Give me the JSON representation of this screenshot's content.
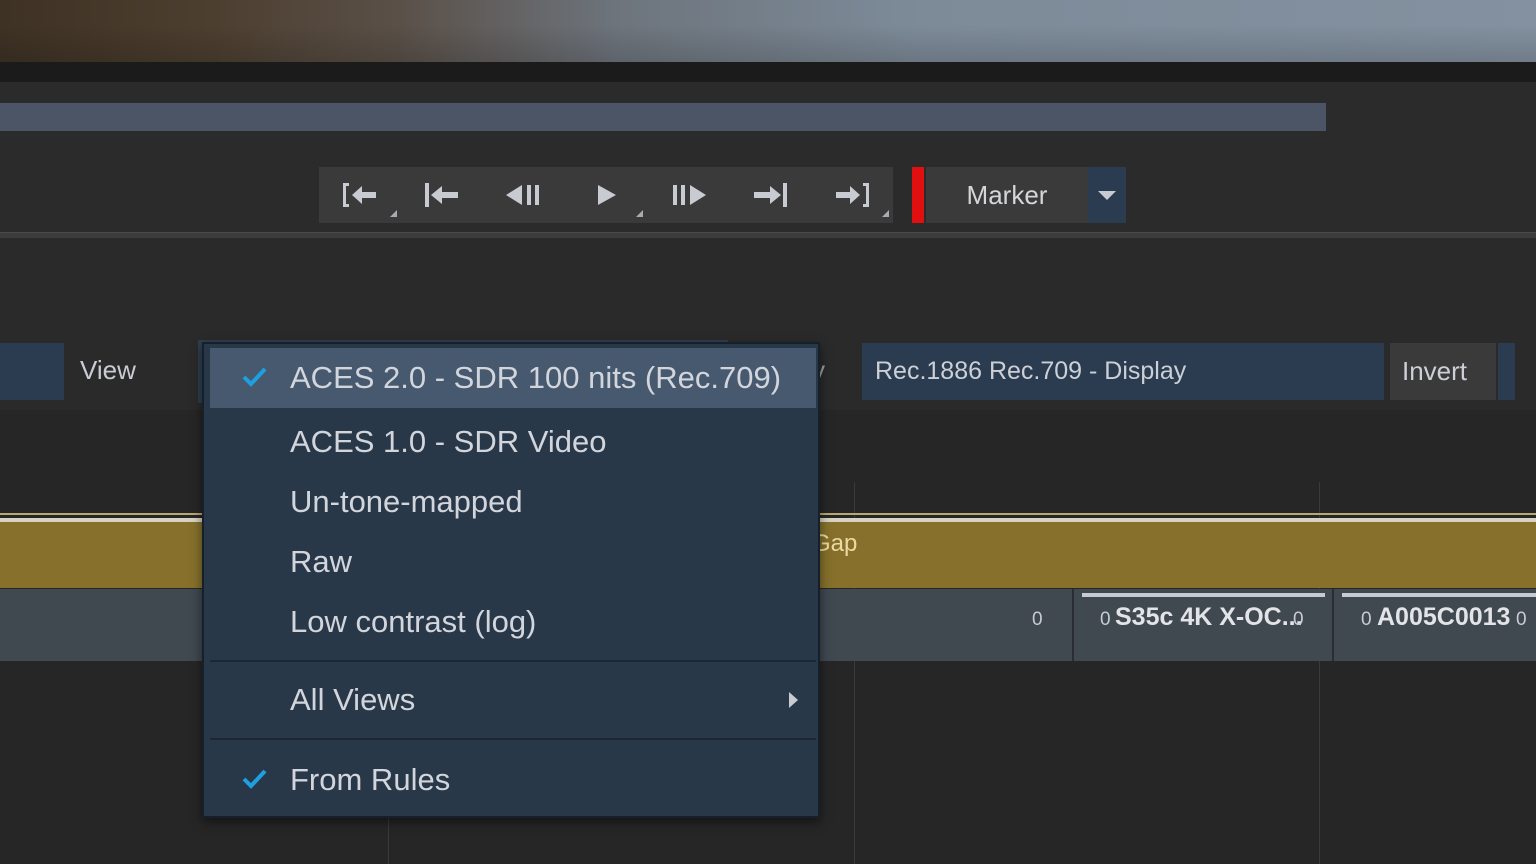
{
  "transport": {
    "buttons": [
      {
        "name": "jump-to-in-point-button",
        "icon": "jump-start-bracket-icon"
      },
      {
        "name": "go-to-start-button",
        "icon": "skip-back-icon"
      },
      {
        "name": "step-back-button",
        "icon": "step-back-icon"
      },
      {
        "name": "play-button",
        "icon": "play-icon"
      },
      {
        "name": "step-forward-button",
        "icon": "step-forward-icon"
      },
      {
        "name": "go-to-end-button",
        "icon": "skip-forward-icon"
      },
      {
        "name": "jump-to-out-point-button",
        "icon": "jump-end-bracket-icon"
      }
    ],
    "marker_label": "Marker",
    "marker_color": "#e01010"
  },
  "color": {
    "view_label": "View",
    "obscured_label_tail": "y",
    "display_value": "Rec.1886 Rec.709 - Display",
    "invert_label": "Invert"
  },
  "menu": {
    "items": [
      {
        "label": "ACES 2.0 - SDR 100 nits (Rec.709)",
        "checked": true,
        "highlighted": true
      },
      {
        "label": "ACES 1.0 - SDR Video",
        "checked": false
      },
      {
        "label": "Un-tone-mapped",
        "checked": false
      },
      {
        "label": "Raw",
        "checked": false
      },
      {
        "label": "Low contrast (log)",
        "checked": false
      }
    ],
    "all_views": {
      "label": "All Views",
      "has_submenu": true
    },
    "from_rules": {
      "label": "From Rules",
      "checked": true
    },
    "check_color": "#1ea0e0"
  },
  "timeline": {
    "gap_label": "Gap",
    "gap_color": "#86702b",
    "clips": [
      {
        "start_num": "",
        "name": "",
        "end_num": "0"
      },
      {
        "start_num": "0",
        "name": "S35c 4K X-OC...",
        "end_num": "0"
      },
      {
        "start_num": "0",
        "name": "A005C0013",
        "end_num": "0"
      }
    ]
  }
}
